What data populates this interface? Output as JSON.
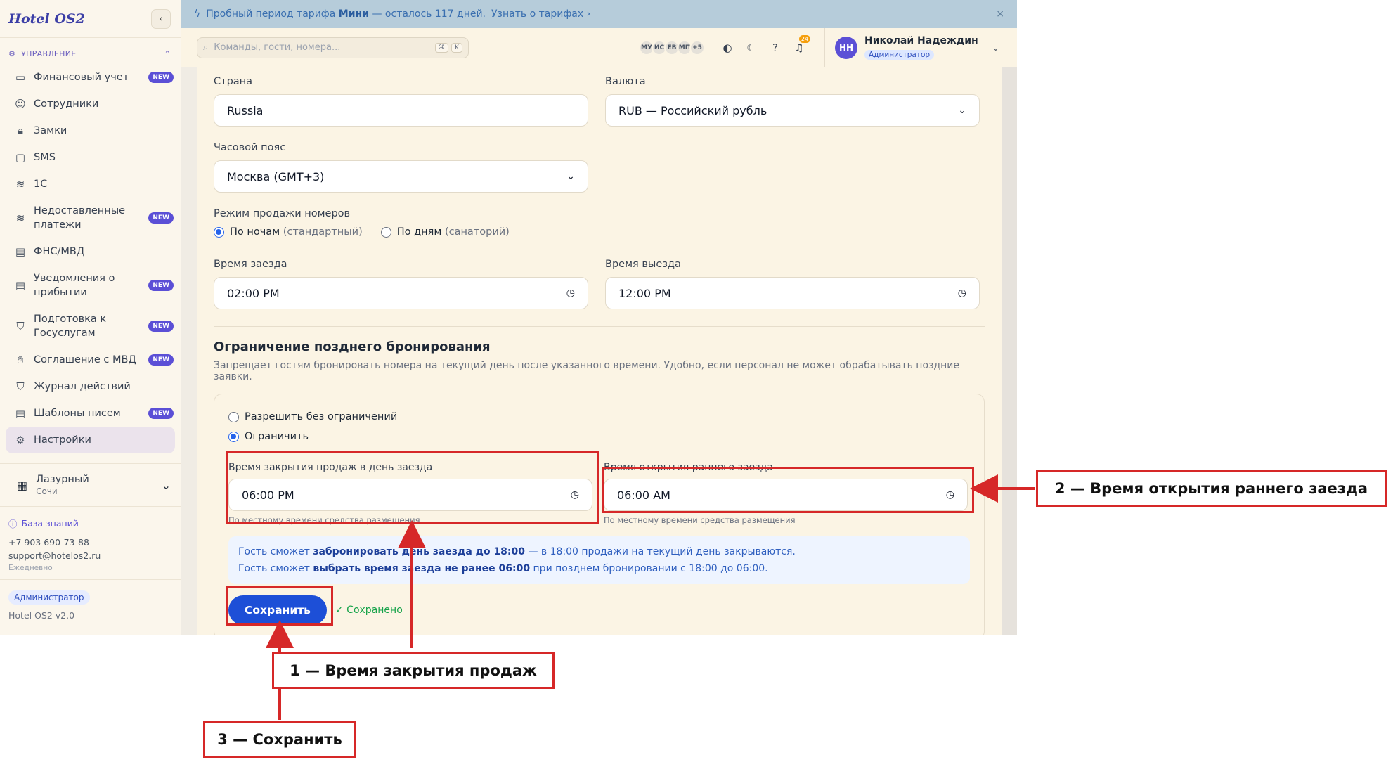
{
  "sidebar": {
    "brand": "Hotel OS2",
    "section_label": "УПРАВЛЕНИЕ",
    "items": [
      {
        "label": "Финансовый учет",
        "badge": "NEW",
        "icon": "wallet-icon"
      },
      {
        "label": "Сотрудники",
        "badge": "",
        "icon": "users-icon"
      },
      {
        "label": "Замки",
        "badge": "",
        "icon": "lock-icon"
      },
      {
        "label": "SMS",
        "badge": "",
        "icon": "message-icon"
      },
      {
        "label": "1С",
        "badge": "",
        "icon": "database-icon"
      },
      {
        "label": "Недоставленные платежи",
        "badge": "NEW",
        "icon": "database-icon"
      },
      {
        "label": "ФНС/МВД",
        "badge": "",
        "icon": "document-icon"
      },
      {
        "label": "Уведомления о прибытии",
        "badge": "NEW",
        "icon": "document-icon"
      },
      {
        "label": "Подготовка к Госуслугам",
        "badge": "NEW",
        "icon": "shield-icon"
      },
      {
        "label": "Соглашение с МВД",
        "badge": "NEW",
        "icon": "handshake-icon"
      },
      {
        "label": "Журнал действий",
        "badge": "",
        "icon": "shield-alert-icon"
      },
      {
        "label": "Шаблоны писем",
        "badge": "NEW",
        "icon": "document-icon"
      },
      {
        "label": "Настройки",
        "badge": "",
        "icon": "gear-icon"
      }
    ],
    "hotel": {
      "name": "Лазурный",
      "city": "Сочи"
    },
    "support": {
      "kb_label": "База знаний",
      "phone": "+7 903 690-73-88",
      "email": "support@hotelos2.ru",
      "hours": "Ежедневно"
    },
    "role": "Администратор",
    "version": "Hotel OS2 v2.0"
  },
  "trial_banner": {
    "prefix": "Пробный период тарифа",
    "plan": "Мини",
    "suffix": "— осталось 117 дней.",
    "link": "Узнать о тарифах"
  },
  "topbar": {
    "search_placeholder": "Команды, гости, номера...",
    "kbd": [
      "⌘",
      "K"
    ],
    "presence": [
      "МУ",
      "ИС",
      "ЕВ",
      "МП",
      "+5"
    ],
    "notif_count": "24",
    "user_initials": "НН",
    "user_name": "Николай Надеждин",
    "user_role": "Администратор"
  },
  "form": {
    "country_label": "Страна",
    "country_value": "Russia",
    "currency_label": "Валюта",
    "currency_value": "RUB — Российский рубль",
    "tz_label": "Часовой пояс",
    "tz_value": "Москва (GMT+3)",
    "sale_mode_label": "Режим продажи номеров",
    "sale_mode_opt1": "По ночам",
    "sale_mode_opt1_hint": "(стандартный)",
    "sale_mode_opt2": "По дням",
    "sale_mode_opt2_hint": "(санаторий)",
    "checkin_label": "Время заезда",
    "checkin_value": "02:00 PM",
    "checkout_label": "Время выезда",
    "checkout_value": "12:00 PM",
    "late_title": "Ограничение позднего бронирования",
    "late_desc": "Запрещает гостям бронировать номера на текущий день после указанного времени. Удобно, если персонал не может обрабатывать поздние заявки.",
    "opt_allow": "Разрешить без ограничений",
    "opt_limit": "Ограничить",
    "close_label": "Время закрытия продаж в день заезда",
    "close_value": "06:00 PM",
    "close_hint": "По местному времени средства размещения",
    "early_label": "Время открытия раннего заезда",
    "early_value": "06:00 AM",
    "early_hint": "По местному времени средства размещения",
    "info1_pre": "Гость сможет",
    "info1_bold": "забронировать день заезда до 18:00",
    "info1_post": "— в 18:00 продажи на текущий день закрываются.",
    "info2_pre": "Гость сможет",
    "info2_bold": "выбрать время заезда не ранее 06:00",
    "info2_post": "при позднем бронировании с 18:00 до 06:00.",
    "save_label": "Сохранить",
    "saved_label": "✓ Сохранено"
  },
  "annotations": {
    "a1": "1 — Время закрытия продаж",
    "a2": "2 — Время открытия раннего заезда",
    "a3": "3 — Сохранить"
  },
  "colors": {
    "accent": "#5b4fd6",
    "primary_button": "#1d4fd7",
    "annotation": "#d62828"
  }
}
